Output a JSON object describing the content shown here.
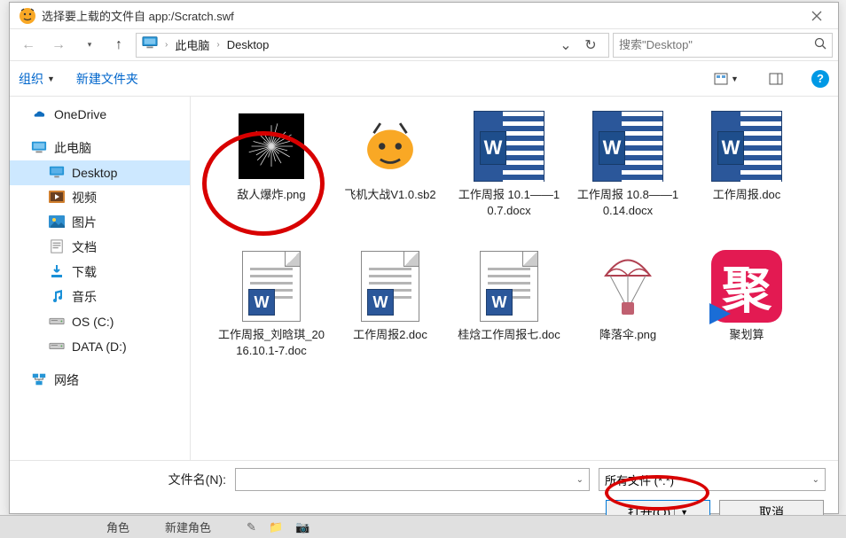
{
  "window": {
    "title": "选择要上载的文件自 app:/Scratch.swf"
  },
  "nav": {
    "crumbs": [
      "此电脑",
      "Desktop"
    ],
    "search_placeholder": "搜索\"Desktop\""
  },
  "toolbar": {
    "organize": "组织",
    "new_folder": "新建文件夹"
  },
  "sidebar": {
    "items": [
      {
        "label": "OneDrive",
        "icon": "onedrive"
      },
      {
        "label": "此电脑",
        "icon": "pc"
      },
      {
        "label": "Desktop",
        "icon": "desktop",
        "child": true,
        "selected": true
      },
      {
        "label": "视频",
        "icon": "video",
        "child": true
      },
      {
        "label": "图片",
        "icon": "pictures",
        "child": true
      },
      {
        "label": "文档",
        "icon": "docs",
        "child": true
      },
      {
        "label": "下载",
        "icon": "downloads",
        "child": true
      },
      {
        "label": "音乐",
        "icon": "music",
        "child": true
      },
      {
        "label": "OS (C:)",
        "icon": "drive",
        "child": true
      },
      {
        "label": "DATA (D:)",
        "icon": "drive",
        "child": true
      },
      {
        "label": "网络",
        "icon": "network"
      }
    ]
  },
  "files": [
    {
      "name": "敌人爆炸.png",
      "type": "explosion"
    },
    {
      "name": "飞机大战V1.0.sb2",
      "type": "scratch"
    },
    {
      "name": "工作周报 10.1——10.7.docx",
      "type": "wordlarge"
    },
    {
      "name": "工作周报 10.8——10.14.docx",
      "type": "wordlarge"
    },
    {
      "name": "工作周报.doc",
      "type": "wordlarge"
    },
    {
      "name": "工作周报_刘晗琪_2016.10.1-7.doc",
      "type": "worddoc"
    },
    {
      "name": "工作周报2.doc",
      "type": "worddoc"
    },
    {
      "name": "桂焓工作周报七.doc",
      "type": "worddoc"
    },
    {
      "name": "降落伞.png",
      "type": "parachute"
    },
    {
      "name": "聚划算",
      "type": "ju"
    }
  ],
  "footer": {
    "filename_label": "文件名(N):",
    "filter": "所有文件 (*.*)",
    "open": "打开(O)",
    "cancel": "取消"
  },
  "bottomstrip": {
    "t1": "角色",
    "t2": "新建角色"
  }
}
